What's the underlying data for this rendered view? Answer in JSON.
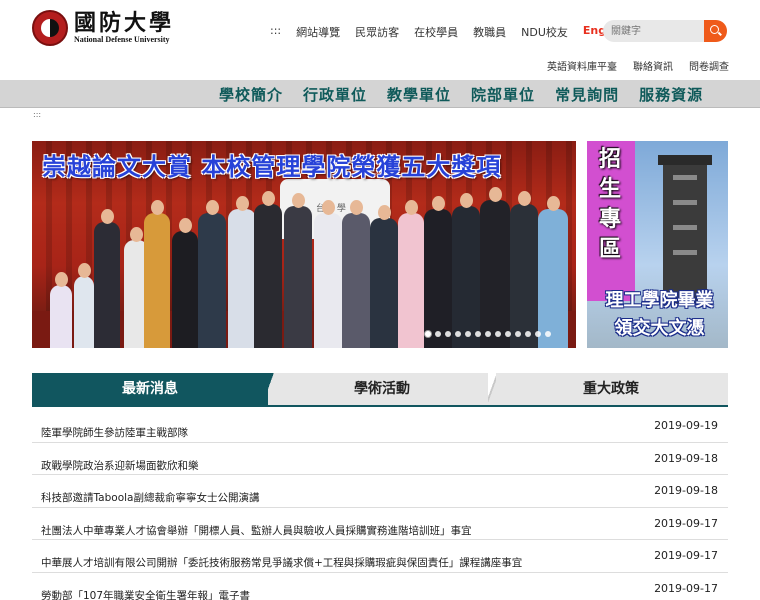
{
  "header": {
    "logo_cn": "國防大學",
    "logo_en": "National Defense University",
    "accesskey_top": ":::",
    "topnav": [
      "網站導覽",
      "民眾訪客",
      "在校學員",
      "教職員",
      "NDU校友"
    ],
    "lang": "English",
    "search_placeholder": "關鍵字",
    "subnav": [
      "英語資料庫平臺",
      "聯絡資訊",
      "問卷調查"
    ]
  },
  "mainnav": [
    "學校簡介",
    "行政單位",
    "教學單位",
    "院部單位",
    "常見詢問",
    "服務資源"
  ],
  "accesskey_center": ":::",
  "banner": {
    "title": "崇越論文大賞 本校管理學院榮獲五大獎項",
    "backdrop_text": "台灣 學",
    "slide_count": 13,
    "active_slide": 1
  },
  "side_banner": {
    "vertical_text": [
      "招",
      "生",
      "專",
      "區"
    ],
    "line1": "理工學院畢業",
    "line2": "領交大文憑"
  },
  "tabs": [
    "最新消息",
    "學術活動",
    "重大政策"
  ],
  "news": [
    {
      "title": "陸軍學院師生參訪陸軍主戰部隊",
      "date": "2019-09-19"
    },
    {
      "title": "政戰學院政治系迎新場面歡欣和樂",
      "date": "2019-09-18"
    },
    {
      "title": "科技部邀請Taboola副總裁俞寧寧女士公開演講",
      "date": "2019-09-18"
    },
    {
      "title": "社團法人中華專業人才協會舉辦「開標人員、監辦人員與驗收人員採購實務進階培訓班」事宜",
      "date": "2019-09-17"
    },
    {
      "title": "中華展人才培訓有限公司開辦「委託技術服務常見爭議求償+工程與採購瑕疵與保固責任」課程講座事宜",
      "date": "2019-09-17"
    },
    {
      "title": "勞動部「107年職業安全衛生署年報」電子書",
      "date": "2019-09-17"
    }
  ],
  "colors": {
    "accent": "#11565f",
    "lang": "#e8301e",
    "search_btn": "#ef5a1a",
    "banner_title": "#2742d8",
    "side_purple": "#d24fd0"
  }
}
